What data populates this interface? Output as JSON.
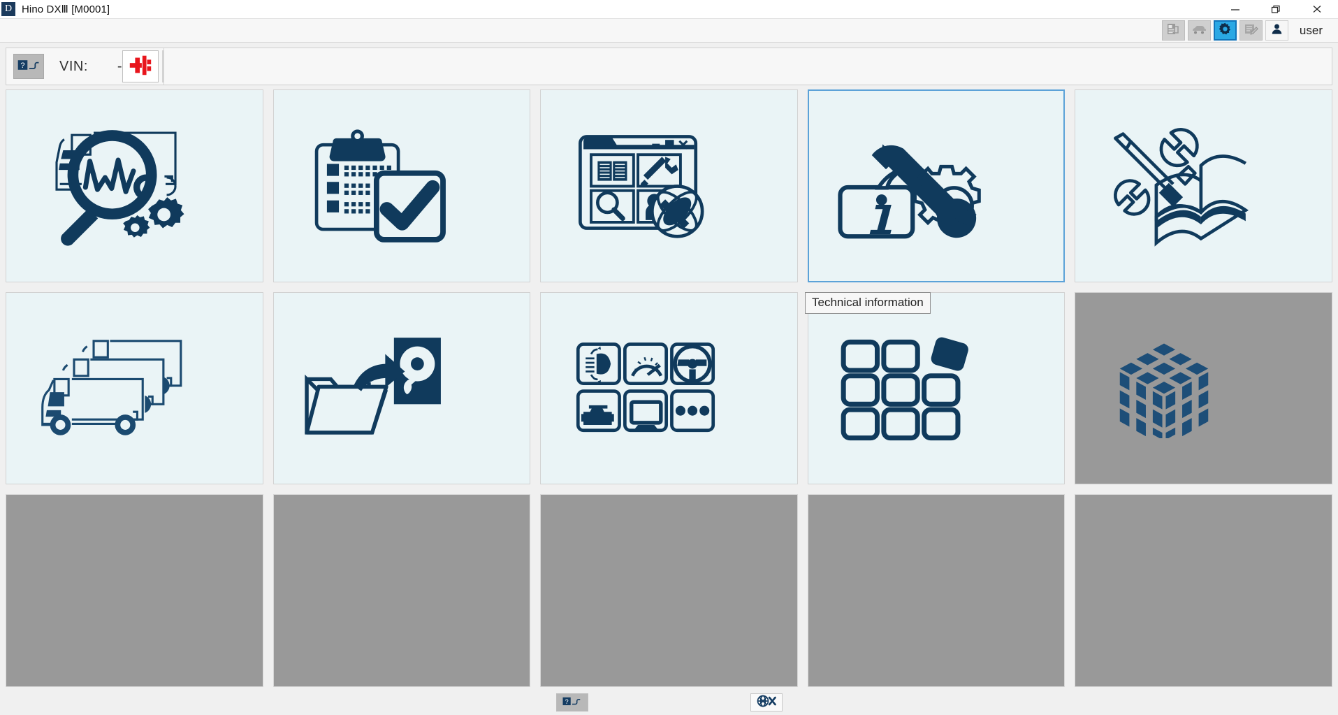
{
  "window": {
    "app_icon_letter": "D",
    "title": "Hino DXⅢ [M0001]",
    "minimize_label": "minimize-icon",
    "maximize_label": "restore-icon",
    "close_label": "close-icon"
  },
  "toolbar": {
    "buttons": [
      {
        "name": "report-icon",
        "state": "disabled"
      },
      {
        "name": "vehicle-icon",
        "state": "disabled"
      },
      {
        "name": "gear-icon",
        "state": "active"
      },
      {
        "name": "edit-note-icon",
        "state": "disabled"
      },
      {
        "name": "user-icon",
        "state": "enabled"
      }
    ],
    "username": "user"
  },
  "vin_bar": {
    "status_icon": "connector-unknown-icon",
    "label": "VIN:",
    "value": "-",
    "connector_icon": "connector-disconnected-icon"
  },
  "tiles": [
    {
      "name": "vehicle-diagnosis-tile",
      "icon": "truck-magnifier-waveform-gears-icon",
      "state": "enabled"
    },
    {
      "name": "inspection-checklist-tile",
      "icon": "clipboard-checkmark-icon",
      "state": "enabled"
    },
    {
      "name": "web-portal-tile",
      "icon": "browser-window-globe-icon",
      "state": "enabled"
    },
    {
      "name": "technical-information-tile",
      "icon": "info-wrench-gear-icon",
      "state": "selected",
      "tooltip": "Technical information"
    },
    {
      "name": "service-manual-tile",
      "icon": "tools-open-book-icon",
      "state": "enabled"
    },
    {
      "name": "vehicle-selection-tile",
      "icon": "three-trucks-icon",
      "state": "enabled"
    },
    {
      "name": "data-backup-tile",
      "icon": "folder-arrow-harddisk-icon",
      "state": "enabled"
    },
    {
      "name": "ecu-systems-tile",
      "icon": "systems-grid-icon",
      "state": "enabled"
    },
    {
      "name": "module-manager-tile",
      "icon": "tile-grid-detached-icon",
      "state": "enabled"
    },
    {
      "name": "data-cube-tile",
      "icon": "isometric-cube-icon",
      "state": "disabled"
    },
    {
      "name": "empty-tile-1",
      "icon": "",
      "state": "empty"
    },
    {
      "name": "empty-tile-2",
      "icon": "",
      "state": "empty"
    },
    {
      "name": "empty-tile-3",
      "icon": "",
      "state": "empty"
    },
    {
      "name": "empty-tile-4",
      "icon": "",
      "state": "empty"
    },
    {
      "name": "empty-tile-5",
      "icon": "",
      "state": "empty"
    }
  ],
  "tooltip": {
    "text": "Technical information"
  },
  "statusbar": {
    "connection_status_icon": "connector-unknown-icon",
    "network_status_icon": "globe-offline-icon"
  },
  "colors": {
    "ink": "#103a5c",
    "tile_background": "#eaf4f6",
    "tile_disabled": "#999999",
    "selection_border": "#5ca2d8",
    "accent_blue": "#2aa8e4",
    "connector_red": "#e8151c",
    "window_background": "#f0f0f0"
  }
}
